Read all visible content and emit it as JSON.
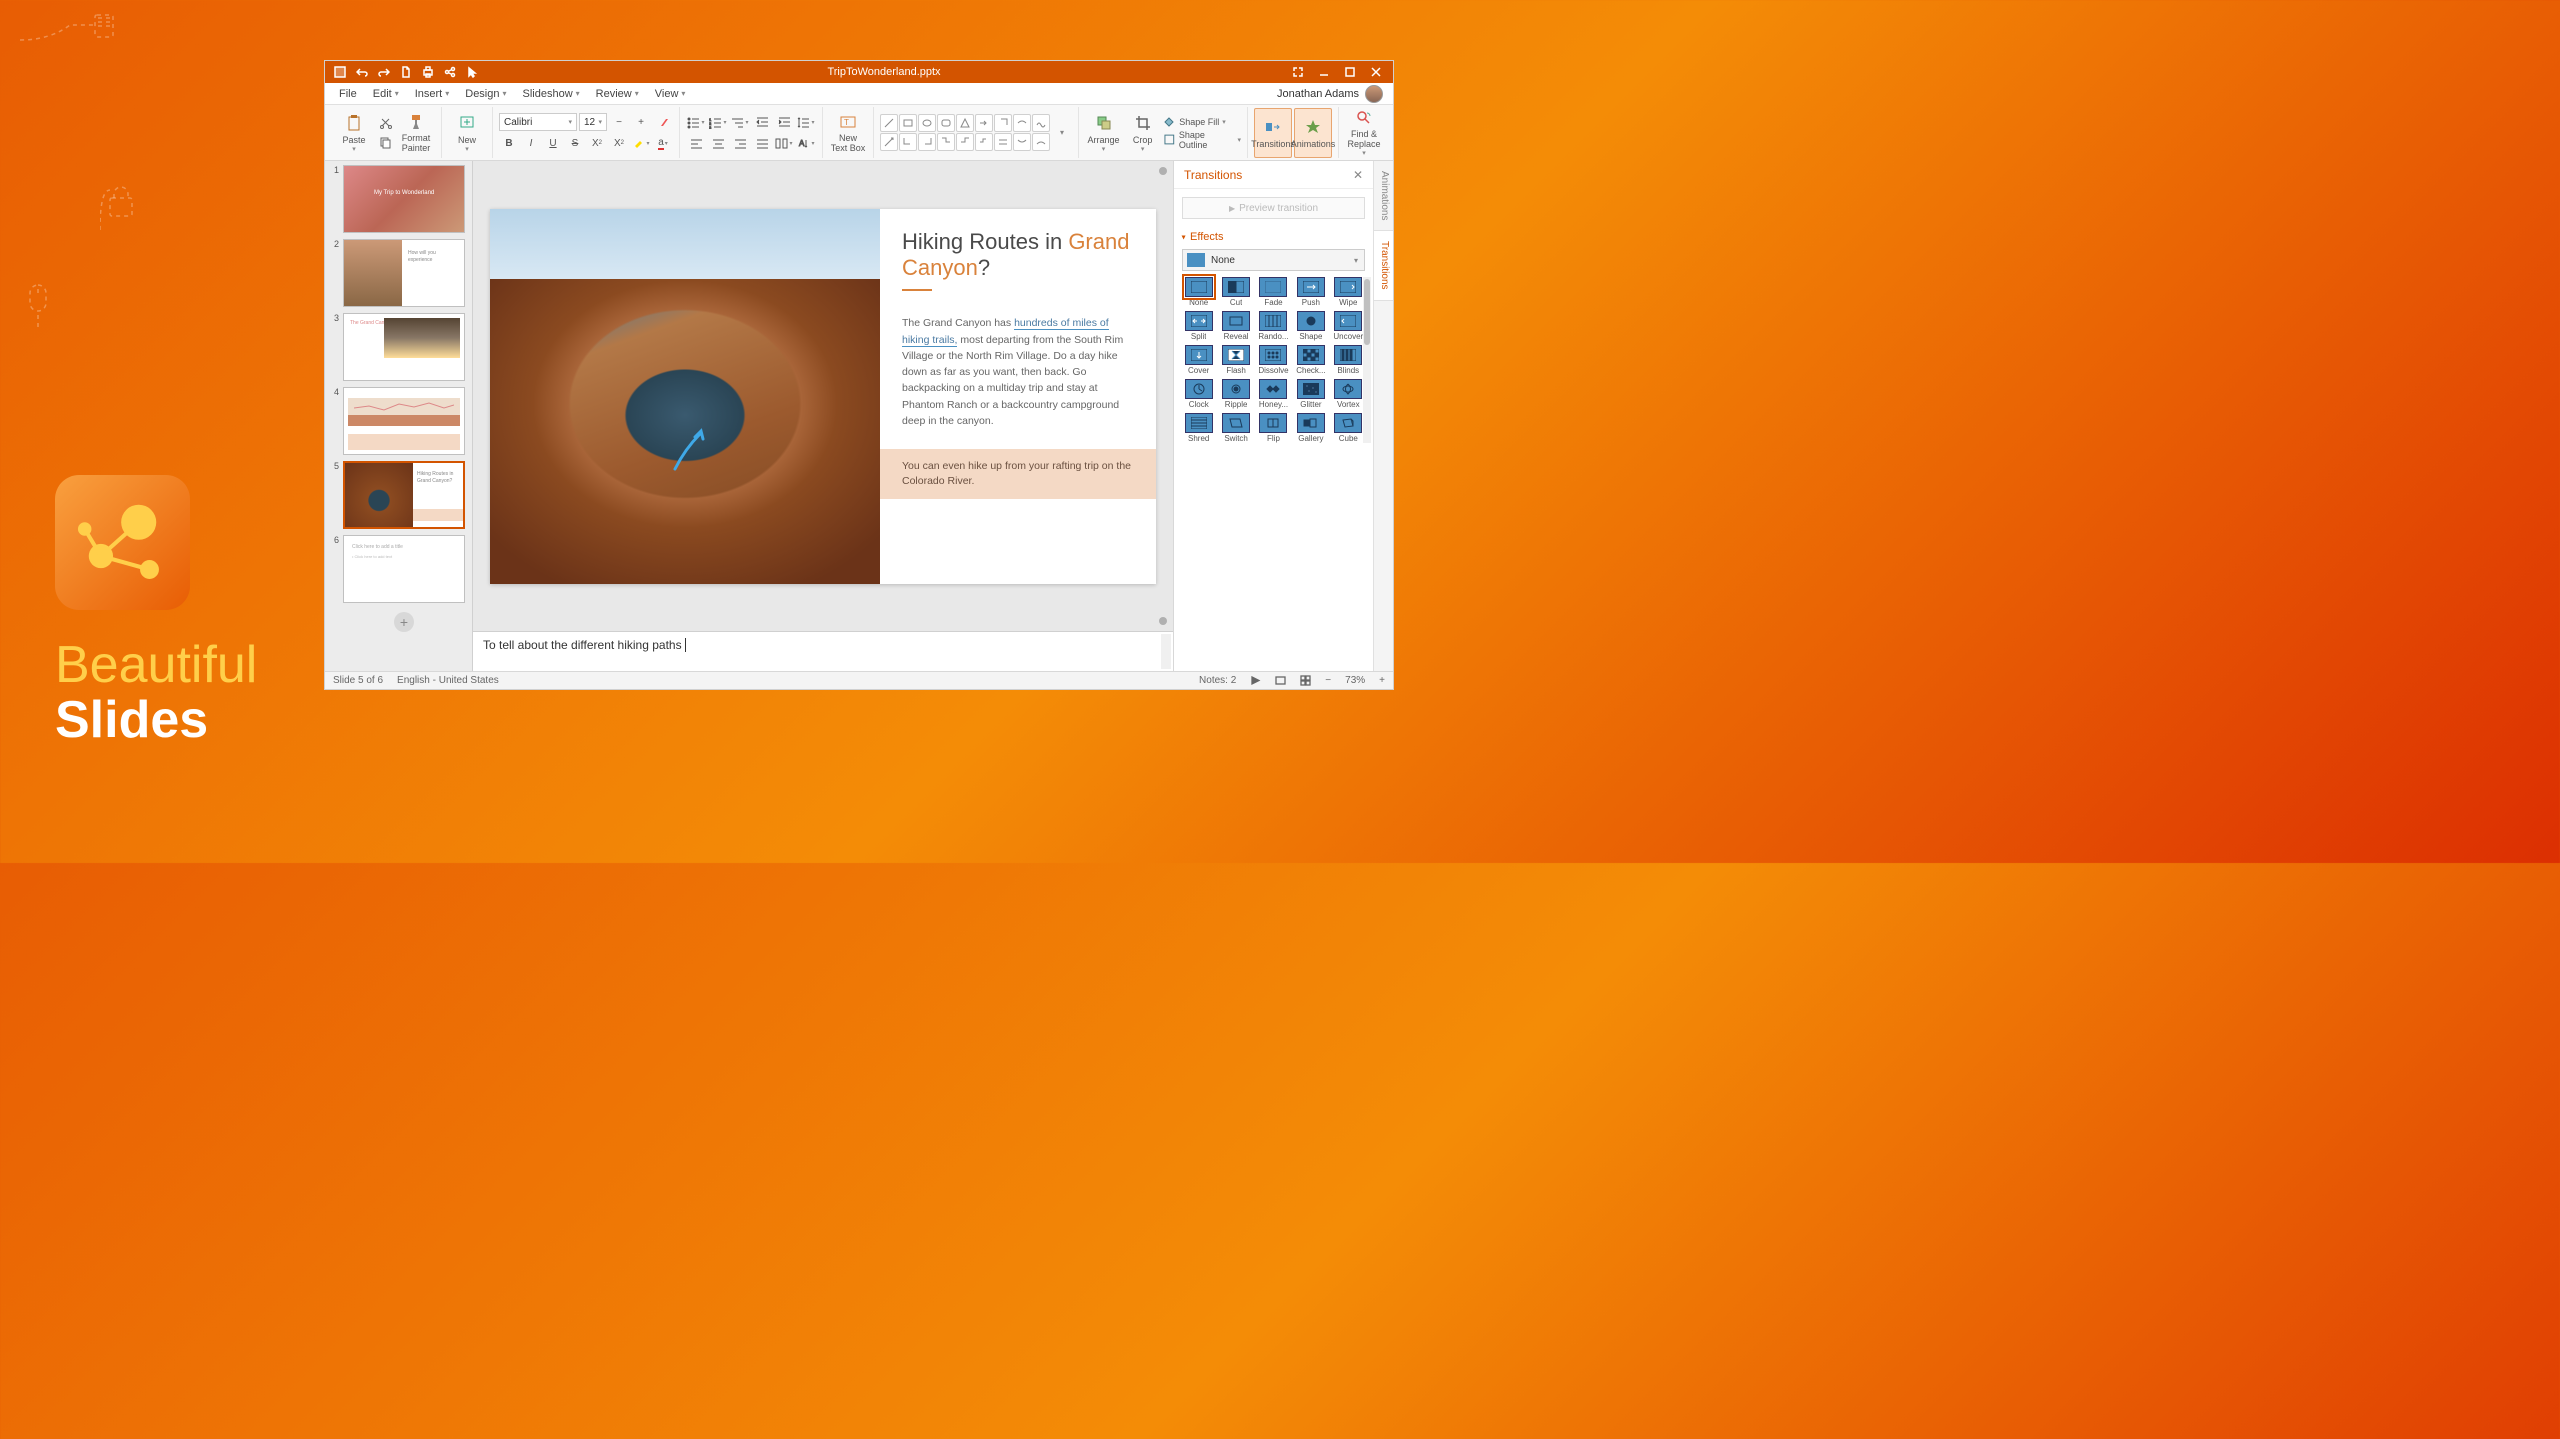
{
  "promo": {
    "line1": "Beautiful",
    "line2": "Slides"
  },
  "titlebar": {
    "filename": "TripToWonderland.pptx"
  },
  "menus": [
    "File",
    "Edit",
    "Insert",
    "Design",
    "Slideshow",
    "Review",
    "View"
  ],
  "user": {
    "name": "Jonathan Adams"
  },
  "ribbon": {
    "paste": "Paste",
    "format_painter": "Format\nPainter",
    "new": "New",
    "font_name": "Calibri",
    "font_size": "12",
    "new_textbox": "New\nText Box",
    "arrange": "Arrange",
    "crop": "Crop",
    "shape_fill": "Shape Fill",
    "shape_outline": "Shape Outline",
    "transitions": "Transitions",
    "animations": "Animations",
    "find_replace": "Find &\nReplace"
  },
  "thumbs": [
    {
      "n": "1",
      "title": "My Trip to Wonderland"
    },
    {
      "n": "2",
      "title": "How will you experience"
    },
    {
      "n": "3",
      "title": "The Grand Canyon"
    },
    {
      "n": "4",
      "title": ""
    },
    {
      "n": "5",
      "title": "Hiking Routes in Grand Canyon?"
    },
    {
      "n": "6",
      "title": "Click here to add a title"
    }
  ],
  "slide": {
    "heading_pre": "Hiking Routes in ",
    "heading_accent": "Grand Canyon",
    "heading_post": "?",
    "body_pre": "The Grand Canyon has ",
    "body_u1": "hundreds of miles of hiking trails,",
    "body_mid": " most departing from the South Rim Village or the North Rim Village. Do a day hike down as far as you want, then back. Go backpacking on a multiday trip and stay at Phantom Ranch or a backcountry campground deep in the canyon.",
    "callout": "You can even hike up from your rafting trip on the Colorado River."
  },
  "notes": {
    "text": "To tell about the different hiking paths"
  },
  "tpane": {
    "title": "Transitions",
    "preview": "Preview transition",
    "effects": "Effects",
    "selected": "None",
    "items": [
      "None",
      "Cut",
      "Fade",
      "Push",
      "Wipe",
      "Split",
      "Reveal",
      "Rando...",
      "Shape",
      "Uncover",
      "Cover",
      "Flash",
      "Dissolve",
      "Check...",
      "Blinds",
      "Clock",
      "Ripple",
      "Honey...",
      "Glitter",
      "Vortex",
      "Shred",
      "Switch",
      "Flip",
      "Gallery",
      "Cube"
    ]
  },
  "sidetabs": {
    "animations": "Animations",
    "transitions": "Transitions"
  },
  "status": {
    "slide": "Slide 5 of 6",
    "lang": "English - United States",
    "notes": "Notes: 2",
    "zoom": "73%"
  }
}
